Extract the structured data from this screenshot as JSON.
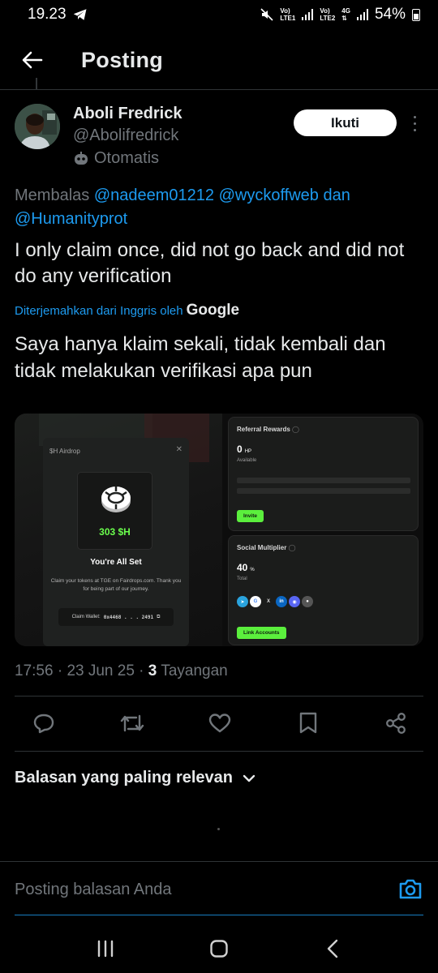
{
  "status_bar": {
    "time": "19.23",
    "sim1": [
      "Vo)",
      "LTE1"
    ],
    "sim2": [
      "Vo)",
      "LTE2"
    ],
    "network": "4G",
    "battery": "54%"
  },
  "app_bar": {
    "title": "Posting"
  },
  "author": {
    "name": "Aboli Fredrick",
    "handle": "@Abolifredrick",
    "automated_label": "Otomatis",
    "follow_label": "Ikuti"
  },
  "reply_to": {
    "prefix": "Membalas",
    "mentions": [
      "@nadeem01212",
      "@wyckoffweb"
    ],
    "joiner": "dan",
    "last_mention": "@Humanityprot"
  },
  "tweet": {
    "text": "I only claim once, did not go back and did not do any verification",
    "translated_from": "Diterjemahkan dari Inggris oleh",
    "translator": "Google",
    "translation": "Saya hanya klaim sekali, tidak kembali dan tidak melakukan verifikasi apa pun"
  },
  "media": {
    "modal_title": "$H Airdrop",
    "coin_amount": "303 $H",
    "all_set": "You're All Set",
    "claim_text": "Claim your tokens at TGE on Fairdrops.com. Thank you for being part of our journey.",
    "wallet_label": "Claim Wallet:",
    "wallet_value": "0x4468 . . . 2491",
    "referral_title": "Referral Rewards",
    "referral_value": "0",
    "referral_unit": "HP",
    "referral_sub": "Available",
    "invite_label": "Invite",
    "social_title": "Social Multiplier",
    "social_value": "40",
    "social_unit": "%",
    "social_sub": "Total",
    "link_label": "Link Accounts"
  },
  "meta": {
    "time": "17:56",
    "date": "23 Jun 25",
    "views_count": "3",
    "views_label": "Tayangan"
  },
  "actions": [
    "reply-icon",
    "retweet-icon",
    "like-icon",
    "bookmark-icon",
    "share-icon"
  ],
  "replies": {
    "sort_label": "Balasan yang paling relevan"
  },
  "reply_bar": {
    "placeholder": "Posting balasan Anda"
  },
  "colors": {
    "accent": "#1d9bf0",
    "background": "#000000",
    "muted": "#71767b",
    "green": "#5bef3d"
  }
}
